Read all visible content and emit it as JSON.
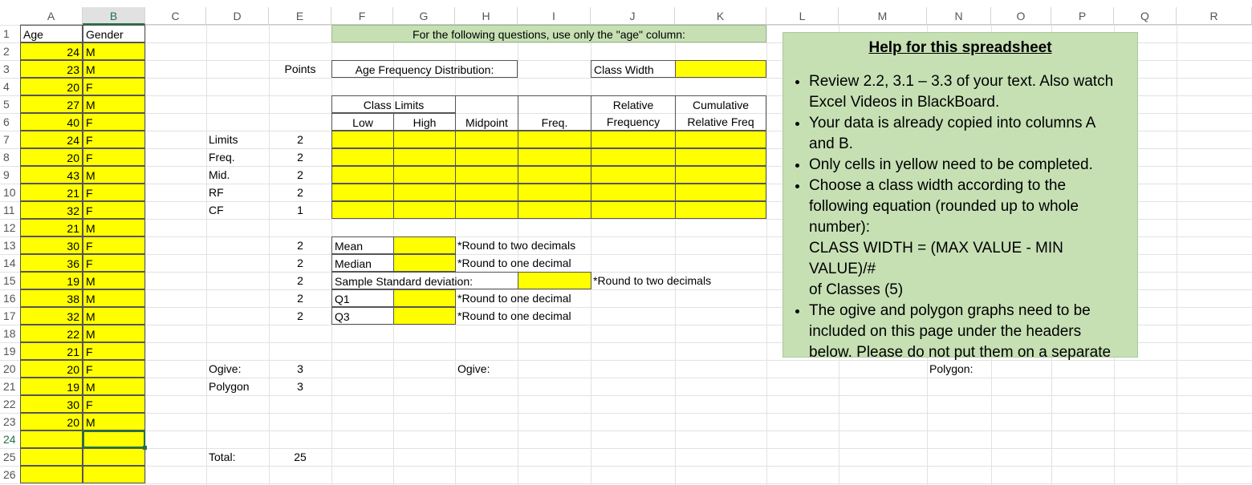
{
  "columns": [
    "A",
    "B",
    "C",
    "D",
    "E",
    "F",
    "G",
    "H",
    "I",
    "J",
    "K",
    "L",
    "M",
    "N",
    "O",
    "P",
    "Q",
    "R"
  ],
  "rows": [
    "1",
    "2",
    "3",
    "4",
    "5",
    "6",
    "7",
    "8",
    "9",
    "10",
    "11",
    "12",
    "13",
    "14",
    "15",
    "16",
    "17",
    "18",
    "19",
    "20",
    "21",
    "22",
    "23",
    "24",
    "25",
    "26"
  ],
  "data_headers": {
    "age": "Age",
    "gender": "Gender"
  },
  "ages": [
    "24",
    "23",
    "20",
    "27",
    "40",
    "24",
    "20",
    "43",
    "21",
    "32",
    "21",
    "30",
    "36",
    "19",
    "38",
    "32",
    "22",
    "21",
    "20",
    "19",
    "30",
    "20"
  ],
  "genders": [
    "M",
    "M",
    "F",
    "M",
    "F",
    "F",
    "F",
    "M",
    "F",
    "F",
    "M",
    "F",
    "F",
    "M",
    "M",
    "M",
    "M",
    "F",
    "F",
    "M",
    "F",
    "M"
  ],
  "banner": "For the following questions, use only the \"age\" column:",
  "points_header": "Points",
  "age_freq_label": "Age Frequency Distribution:",
  "class_width_label": "Class Width",
  "table_headers": {
    "class_limits": "Class Limits",
    "low": "Low",
    "high": "High",
    "midpoint": "Midpoint",
    "freq": "Freq.",
    "relative1": "Relative",
    "relative2": "Frequency",
    "cumulative1": "Cumulative",
    "cumulative2": "Relative Freq"
  },
  "points_rows": [
    {
      "label": "Limits",
      "pts": "2"
    },
    {
      "label": "Freq.",
      "pts": "2"
    },
    {
      "label": "Mid.",
      "pts": "2"
    },
    {
      "label": "RF",
      "pts": "2"
    },
    {
      "label": "CF",
      "pts": "1"
    }
  ],
  "stats_points": [
    "2",
    "2",
    "2",
    "2",
    "2"
  ],
  "stats": {
    "mean": "Mean",
    "median": "Median",
    "sd": "Sample Standard deviation:",
    "q1": "Q1",
    "q3": "Q3",
    "round2": "*Round to two decimals",
    "round1": "*Round to one decimal"
  },
  "graphs": {
    "ogive": "Ogive:",
    "polygon": "Polygon:",
    "ogive_pts": "3",
    "polygon_row": "Polygon",
    "polygon_pts": "3"
  },
  "total": {
    "label": "Total:",
    "value": "25"
  },
  "help": {
    "title": "Help for this spreadsheet",
    "b1a": "Review 2.2, 3.1 – 3.3 of your text. Also watch",
    "b1b": "Excel Videos in BlackBoard.",
    "b2a": "Your data is already copied into columns A",
    "b2b": "and B.",
    "b3": "Only cells in yellow need to be completed.",
    "b4a": "Choose a class width according to the",
    "b4b": "following equation (rounded up to whole",
    "b4c": "number):",
    "b4d": "CLASS WIDTH = (MAX VALUE - MIN VALUE)/#",
    "b4e": "of Classes (5)",
    "b5a": "The ogive and polygon graphs need to be",
    "b5b": "included on this page under the headers",
    "b5c": "below. Please do not put them on a separate"
  },
  "colors": {
    "yellow": "#ffff00",
    "green_banner": "#c6e0b4",
    "excel_green": "#217346"
  }
}
